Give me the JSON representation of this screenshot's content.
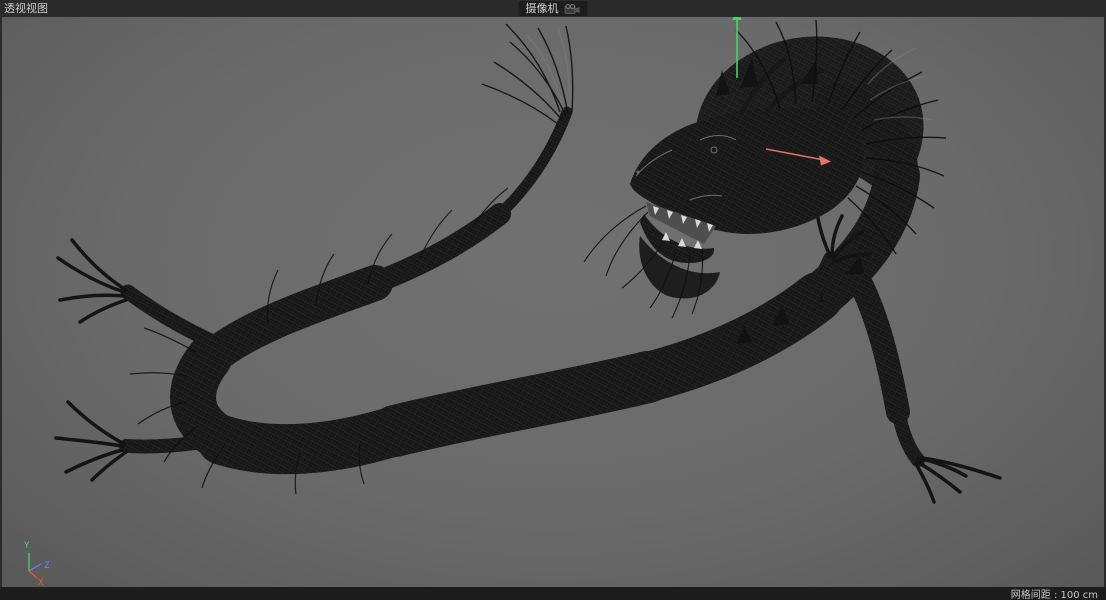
{
  "top_bar": {
    "viewport_label": "透视视图",
    "camera_tab": {
      "label": "摄像机",
      "icon": "camera-icon"
    }
  },
  "viewport": {
    "model_description": "Chinese dragon wireframe 3D model",
    "wireframe_color": "#161616",
    "background_color": "#6a6a6a",
    "manipulator": {
      "y_axis_color": "#3fd95f",
      "x_axis_color": "#e0756b"
    }
  },
  "axis_gizmo": {
    "x_label": "X",
    "y_label": "Y",
    "z_label": "Z",
    "x_color": "#ff4b3e",
    "y_color": "#4ddb63",
    "z_color": "#5b8cff"
  },
  "status_bar": {
    "grid_spacing": "网格间距 : 100 cm"
  },
  "colors": {
    "chrome_bg": "#2b2b2b",
    "tab_bg": "#1d1d1d"
  }
}
